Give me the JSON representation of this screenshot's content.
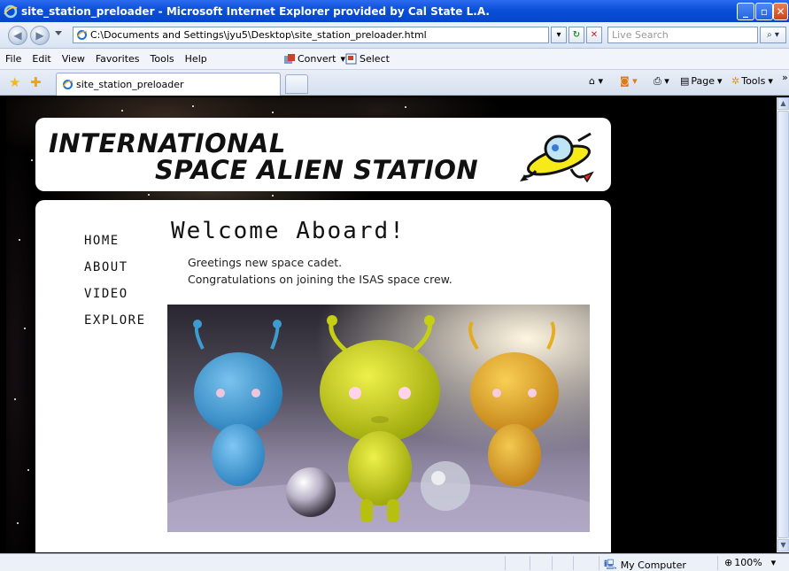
{
  "window": {
    "title": "site_station_preloader - Microsoft Internet Explorer provided by Cal State L.A.",
    "minimize": "_",
    "maximize": "▫",
    "close": "✕"
  },
  "address_bar": {
    "url": "C:\\Documents and Settings\\jyu5\\Desktop\\site_station_preloader.html",
    "search_placeholder": "Live Search"
  },
  "menu": {
    "items": [
      "File",
      "Edit",
      "View",
      "Favorites",
      "Tools",
      "Help"
    ],
    "convert_label": "Convert",
    "select_label": "Select"
  },
  "tabs": {
    "active_tab": "site_station_preloader",
    "page_label": "Page",
    "tools_label": "Tools",
    "chevron": "»"
  },
  "page": {
    "header_line1": "INTERNATIONAL",
    "header_line2": "SPACE ALIEN STATION",
    "nav": [
      "HOME",
      "ABOUT",
      "VIDEO",
      "EXPLORE"
    ],
    "welcome": "Welcome Aboard!",
    "greeting_line1": "Greetings new space cadet.",
    "greeting_line2": "Congratulations on joining the ISAS space crew."
  },
  "status_bar": {
    "zone": "My Computer",
    "zoom": "100%"
  },
  "colors": {
    "title_bar": "#0a4fd8",
    "page_background": "#000000",
    "panel": "#ffffff",
    "alien_blue": "#3fa7e0",
    "alien_yellow": "#c7cf12",
    "alien_orange": "#e8a90e"
  }
}
